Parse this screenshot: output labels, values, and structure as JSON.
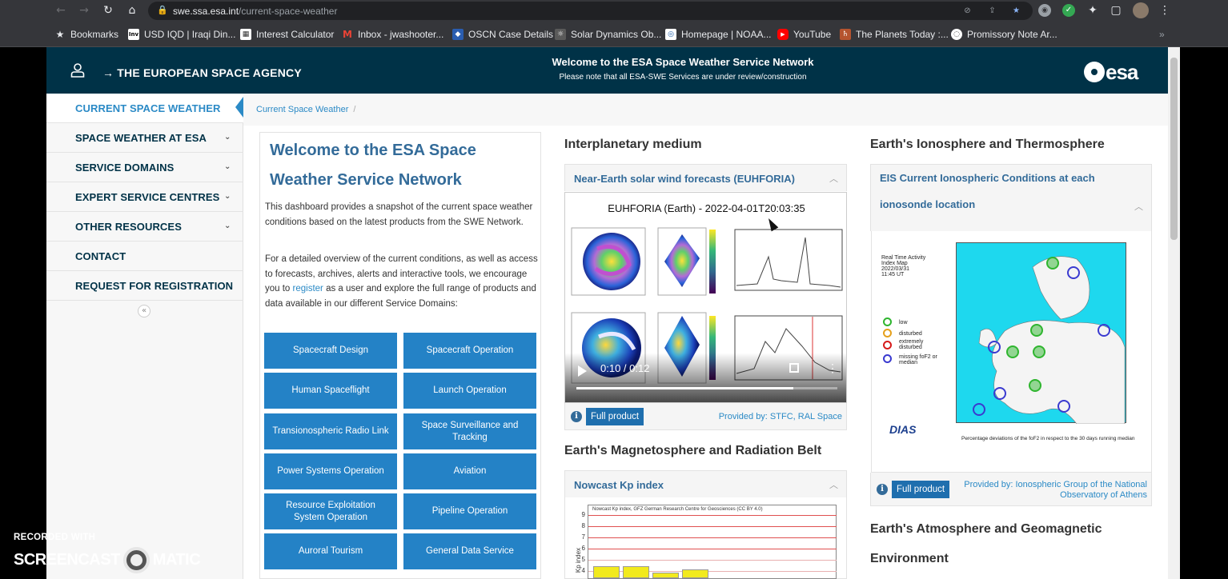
{
  "browser": {
    "url_host": "swe.ssa.esa.int",
    "url_path": "/current-space-weather",
    "bookmarks": [
      {
        "label": "Bookmarks",
        "icon": "star-icon"
      },
      {
        "label": "USD IQD | Iraqi Din...",
        "icon": "inv-favicon"
      },
      {
        "label": "Interest Calculator",
        "icon": "calculator-favicon"
      },
      {
        "label": "Inbox - jwashooter...",
        "icon": "gmail-favicon"
      },
      {
        "label": "OSCN Case Details",
        "icon": "shield-favicon"
      },
      {
        "label": "Solar Dynamics Ob...",
        "icon": "sdo-favicon"
      },
      {
        "label": "Homepage | NOAA...",
        "icon": "noaa-favicon"
      },
      {
        "label": "YouTube",
        "icon": "youtube-favicon"
      },
      {
        "label": "The Planets Today :...",
        "icon": "planets-favicon"
      },
      {
        "label": "Promissory Note Ar...",
        "icon": "note-favicon"
      }
    ],
    "more_bookmarks": "»"
  },
  "header": {
    "agency": "→ THE EUROPEAN SPACE AGENCY",
    "welcome": "Welcome to the ESA Space Weather Service Network",
    "note": "Please note that all ESA-SWE Services are under review/construction",
    "logo_text": "esa",
    "colors": {
      "bar": "#003247",
      "accent": "#2b8ac6",
      "button": "#2482c6"
    }
  },
  "sidebar": {
    "items": [
      {
        "label": "CURRENT SPACE WEATHER",
        "active": true
      },
      {
        "label": "SPACE WEATHER AT ESA",
        "expandable": true
      },
      {
        "label": "SERVICE DOMAINS",
        "expandable": true
      },
      {
        "label": "EXPERT SERVICE CENTRES",
        "expandable": true
      },
      {
        "label": "OTHER RESOURCES",
        "expandable": true
      },
      {
        "label": "CONTACT"
      },
      {
        "label": "REQUEST FOR REGISTRATION"
      }
    ],
    "collapse_glyph": "«"
  },
  "breadcrumb": {
    "current": "Current Space Weather",
    "separator": "/"
  },
  "welcome": {
    "title": "Welcome to the ESA Space Weather Service Network",
    "para1": "This dashboard provides a snapshot of the current space weather conditions based on the latest products from the SWE Network.",
    "para2_pre": "For a detailed overview of the current conditions, as well as access to forecasts, archives, alerts and interactive tools, we encourage you to ",
    "para2_link": "register",
    "para2_post": " as a user and explore the full range of products and data available in our different Service Domains:",
    "domains": [
      "Spacecraft Design",
      "Spacecraft Operation",
      "Human Spaceflight",
      "Launch Operation",
      "Transionospheric Radio Link",
      "Space Surveillance and Tracking",
      "Power Systems Operation",
      "Aviation",
      "Resource Exploitation System Operation",
      "Pipeline Operation",
      "Auroral Tourism",
      "General Data Service"
    ]
  },
  "interplanetary": {
    "section_title": "Interplanetary medium",
    "card_title": "Near-Earth solar wind forecasts (EUHFORIA)",
    "video_title": "EUHFORIA (Earth) -  2022-04-01T20:03:35",
    "time": "0:10 / 0:12",
    "progress": 0.83,
    "full_product": "Full product",
    "provided_by": "Provided by: STFC, RAL Space"
  },
  "magnetosphere": {
    "section_title": "Earth's Magnetosphere and Radiation Belt",
    "card_title": "Nowcast Kp index",
    "chart_title": "Nowcast Kp index, GFZ German Research Centre for Geosciences (CC BY 4.0)",
    "ylabel": "Kp index",
    "ticks": [
      "9",
      "8",
      "7",
      "6",
      "5",
      "4"
    ]
  },
  "chart_data": {
    "type": "bar",
    "title": "Nowcast Kp index, GFZ German Research Centre for Geosciences (CC BY 4.0)",
    "ylabel": "Kp index",
    "ylim": [
      0,
      9
    ],
    "values": [
      4.3,
      4.3,
      3.7,
      4.0
    ]
  },
  "ionosphere": {
    "section_title": "Earth's Ionosphere and Thermosphere",
    "card_title": "EIS Current Ionospheric Conditions at each ionosonde location",
    "map_caption_1": "Real Time Activity",
    "map_caption_2": "Index Map",
    "map_date": "2022/03/31",
    "map_time": "11:45 UT",
    "legend": [
      "low",
      "disturbed",
      "extremely disturbed",
      "missing foF2 or median"
    ],
    "legend_colors": [
      "#2fb52f",
      "#e5a01c",
      "#d61b1b",
      "#3a3ad0"
    ],
    "bottom_text": "Percentage deviations of the foF2 in respect to the 30 days running median",
    "dias": "DIAS",
    "full_product": "Full product",
    "provided_by": "Provided by: Ionospheric Group of the National Observatory of Athens"
  },
  "atmosphere": {
    "section_title": "Earth's Atmosphere and Geomagnetic Environment"
  },
  "watermark": {
    "line1": "RECORDED WITH",
    "line2a": "SCREENCAST",
    "line2b": "MATIC"
  }
}
